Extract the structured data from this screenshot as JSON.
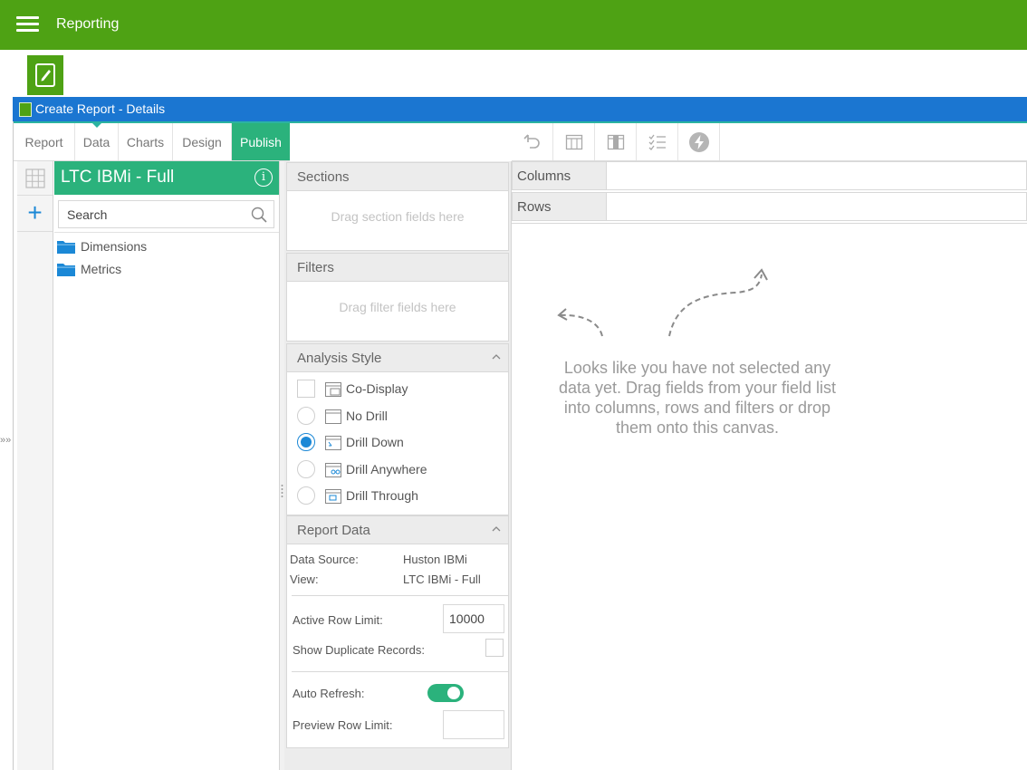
{
  "app": {
    "title": "Reporting"
  },
  "window": {
    "title": "Create Report - Details"
  },
  "tabs": [
    {
      "label": "Report"
    },
    {
      "label": "Data"
    },
    {
      "label": "Charts"
    },
    {
      "label": "Design"
    },
    {
      "label": "Publish",
      "active": true
    }
  ],
  "toolbar_icons": [
    "undo-icon",
    "table-columns-icon",
    "table-split-icon",
    "checklist-icon",
    "lightning-icon"
  ],
  "field_list": {
    "view_name": "LTC IBMi - Full",
    "search_placeholder": "Search",
    "folders": [
      "Dimensions",
      "Metrics"
    ]
  },
  "sections": {
    "title": "Sections",
    "placeholder": "Drag section fields here"
  },
  "filters": {
    "title": "Filters",
    "placeholder": "Drag filter fields here"
  },
  "analysis_style": {
    "title": "Analysis Style",
    "options": [
      {
        "label": "Co-Display",
        "type": "checkbox",
        "selected": false
      },
      {
        "label": "No Drill",
        "type": "radio",
        "selected": false
      },
      {
        "label": "Drill Down",
        "type": "radio",
        "selected": true
      },
      {
        "label": "Drill Anywhere",
        "type": "radio",
        "selected": false
      },
      {
        "label": "Drill Through",
        "type": "radio",
        "selected": false
      }
    ]
  },
  "report_data": {
    "title": "Report Data",
    "data_source_label": "Data Source:",
    "data_source_value": "Huston IBMi",
    "view_label": "View:",
    "view_value": "LTC IBMi - Full",
    "active_row_limit_label": "Active Row Limit:",
    "active_row_limit_value": "10000",
    "show_duplicates_label": "Show Duplicate Records:",
    "auto_refresh_label": "Auto Refresh:",
    "auto_refresh_on": true,
    "preview_row_limit_label": "Preview Row Limit:",
    "preview_row_limit_value": ""
  },
  "canvas": {
    "columns_label": "Columns",
    "rows_label": "Rows",
    "empty_message": "Looks like you have not selected any data yet. Drag fields from your field list into columns, rows and filters or drop them onto this canvas."
  },
  "colors": {
    "topbar": "#4ea214",
    "window_title": "#1b76d1",
    "accent_green": "#2bb27c",
    "radio_blue": "#1b88d6"
  }
}
